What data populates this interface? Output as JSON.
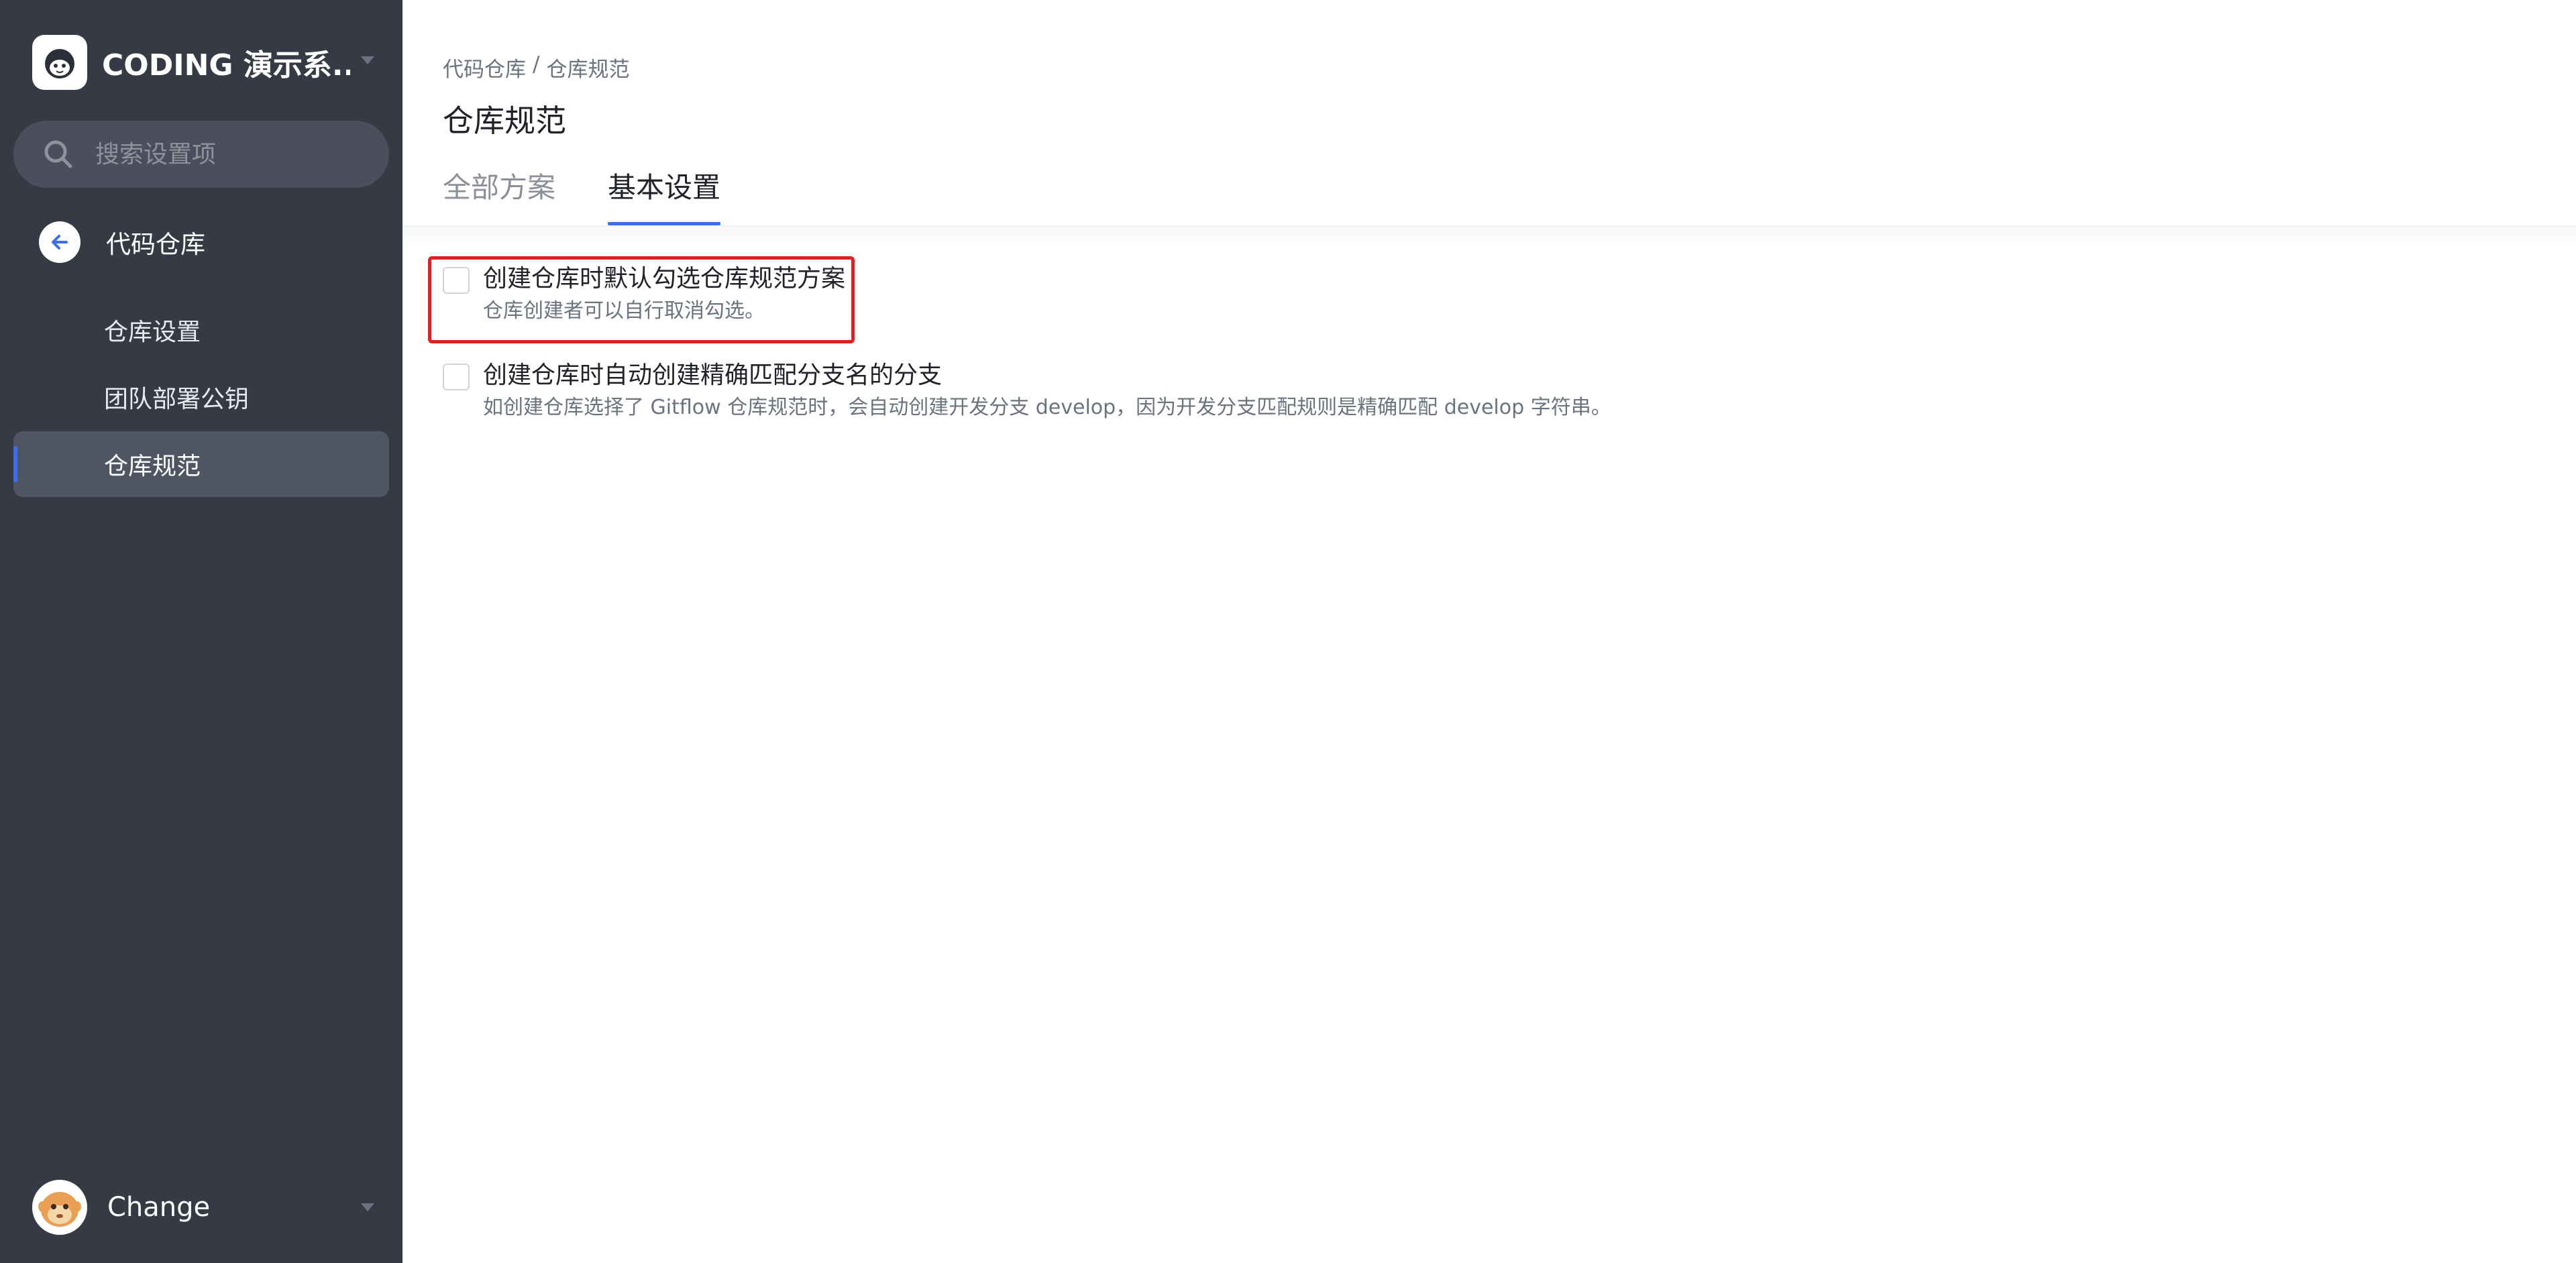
{
  "sidebar": {
    "org_name": "CODING 演示系...",
    "search": {
      "placeholder": "搜索设置项"
    },
    "back_label": "代码仓库",
    "items": [
      {
        "label": "仓库设置",
        "active": false
      },
      {
        "label": "团队部署公钥",
        "active": false
      },
      {
        "label": "仓库规范",
        "active": true
      }
    ],
    "user_name": "Change"
  },
  "main": {
    "breadcrumb": {
      "parent": "代码仓库",
      "separator": "/",
      "current": "仓库规范"
    },
    "title": "仓库规范",
    "tabs": [
      {
        "label": "全部方案",
        "active": false
      },
      {
        "label": "基本设置",
        "active": true
      }
    ],
    "options": [
      {
        "title": "创建仓库时默认勾选仓库规范方案",
        "description": "仓库创建者可以自行取消勾选。",
        "checked": false,
        "highlighted": true
      },
      {
        "title": "创建仓库时自动创建精确匹配分支名的分支",
        "description": "如创建仓库选择了 Gitflow 仓库规范时，会自动创建开发分支 develop，因为开发分支匹配规则是精确匹配 develop 字符串。",
        "checked": false,
        "highlighted": false
      }
    ]
  },
  "colors": {
    "sidebar_bg": "#363a45",
    "accent": "#3c6df0",
    "highlight_border": "#e41f1f"
  }
}
